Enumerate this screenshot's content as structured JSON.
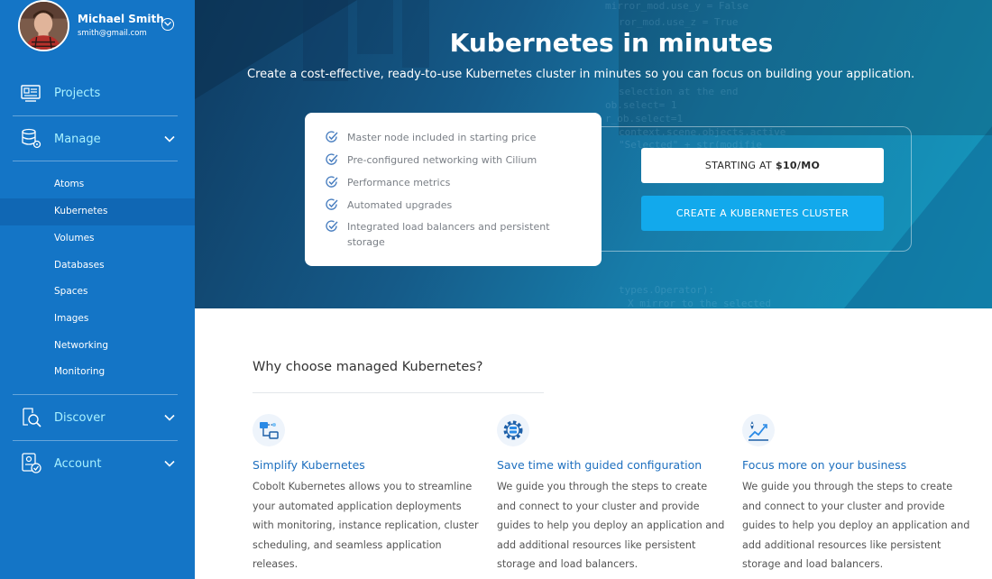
{
  "user": {
    "name": "Michael Smith",
    "email": "smith@gmail.com"
  },
  "sidebar": {
    "projects": {
      "label": "Projects",
      "icon": "projects-icon"
    },
    "manage": {
      "label": "Manage",
      "icon": "database-icon",
      "items": [
        {
          "label": "Atoms"
        },
        {
          "label": "Kubernetes",
          "active": true
        },
        {
          "label": "Volumes"
        },
        {
          "label": "Databases"
        },
        {
          "label": "Spaces"
        },
        {
          "label": "Images"
        },
        {
          "label": "Networking"
        },
        {
          "label": "Monitoring"
        }
      ]
    },
    "discover": {
      "label": "Discover",
      "icon": "discover-icon"
    },
    "account": {
      "label": "Account",
      "icon": "account-icon"
    }
  },
  "hero": {
    "title": "Kubernetes in minutes",
    "subtitle": "Create a cost-effective, ready-to-use Kubernetes cluster in minutes so you can focus on building your application.",
    "features": [
      "Master node included in starting price",
      "Pre-configured networking with Cilium",
      "Performance metrics",
      "Automated upgrades",
      "Integrated load balancers and persistent storage"
    ],
    "starting_prefix": "STARTING AT",
    "starting_price": "$10/MO",
    "create_button": "CREATE A KUBERNETES CLUSTER"
  },
  "why": {
    "title": "Why choose managed Kubernetes?",
    "columns": [
      {
        "icon": "network-diagram-icon",
        "title": "Simplify Kubernetes",
        "text": "Cobolt Kubernetes allows you to streamline your automated application deployments with monitoring, instance replication, cluster scheduling, and seamless application releases."
      },
      {
        "icon": "gear-server-icon",
        "title": "Save time with guided configuration",
        "text": "We guide you through the steps to create and connect to your cluster and provide guides to help you deploy an application and add additional resources like persistent storage and load balancers."
      },
      {
        "icon": "growth-chart-icon",
        "title": "Focus more on your business",
        "text": "We guide you through the steps to create and connect to your cluster and provide guides to help you deploy an application and add additional resources like persistent storage and load balancers."
      }
    ]
  },
  "colors": {
    "sidebar_bg": "#1475c6",
    "sidebar_active": "#1067b4",
    "nav_label": "#a8f1ff",
    "accent": "#12a9ec",
    "link_blue": "#1d6fbf"
  }
}
